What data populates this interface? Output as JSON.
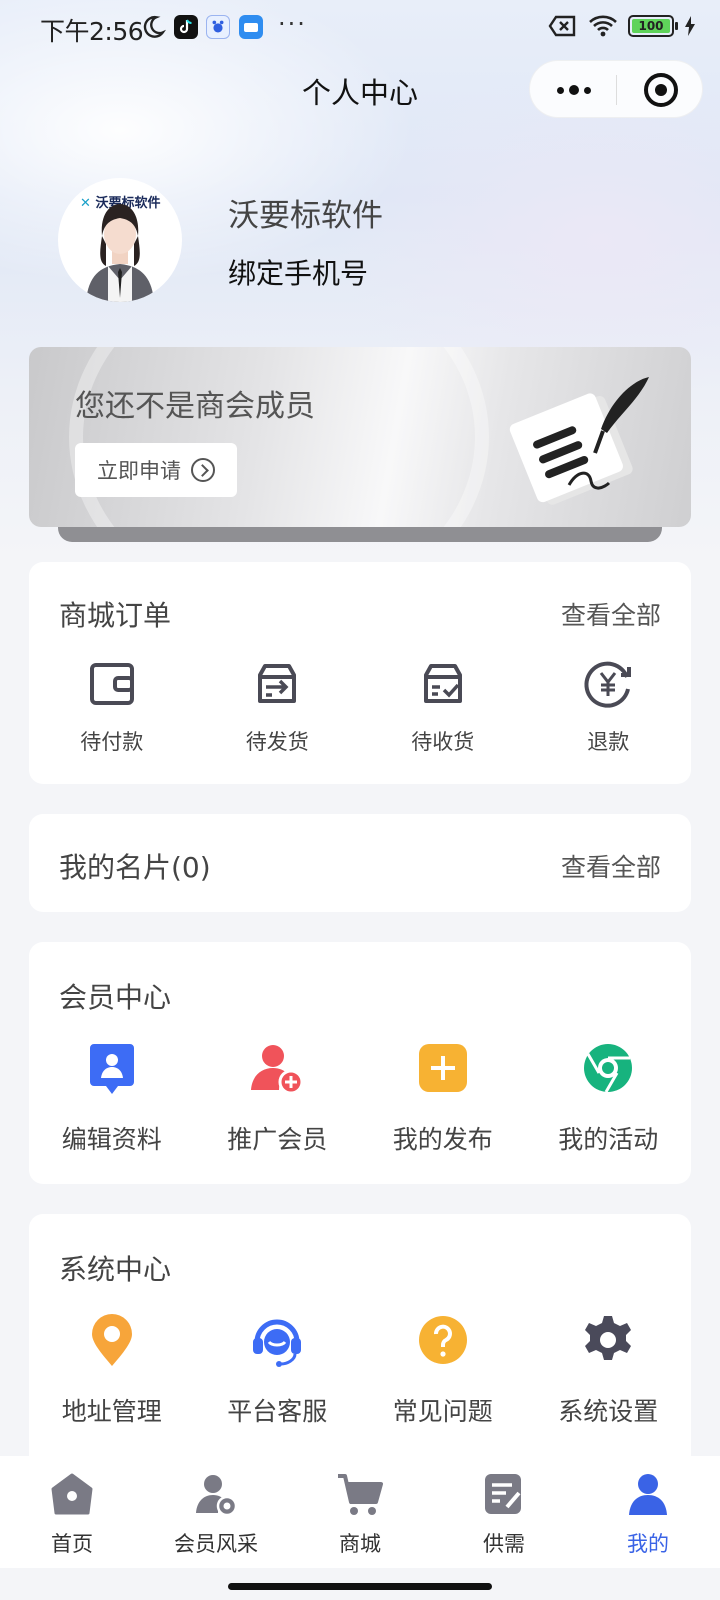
{
  "status_bar": {
    "time": "下午2:56",
    "more": "···",
    "battery": "100",
    "icons": [
      "moon-icon",
      "tiktok-app-icon",
      "baidu-app-icon",
      "wallet-app-icon",
      "sim-x-icon",
      "wifi-icon",
      "battery-icon",
      "charging-icon"
    ]
  },
  "nav": {
    "title": "个人中心",
    "capsule": [
      "more-dots-icon",
      "close-target-icon"
    ]
  },
  "profile": {
    "name": "沃要标软件",
    "bind_phone": "绑定手机号",
    "avatar_logo": "沃要标软件"
  },
  "membership_banner": {
    "title": "您还不是商会成员",
    "apply_button": "立即申请"
  },
  "orders": {
    "title": "商城订单",
    "view_all": "查看全部",
    "items": [
      {
        "label": "待付款",
        "icon": "wallet-icon"
      },
      {
        "label": "待发货",
        "icon": "box-arrow-icon"
      },
      {
        "label": "待收货",
        "icon": "box-check-icon"
      },
      {
        "label": "退款",
        "icon": "refund-yen-icon"
      }
    ]
  },
  "cards_section": {
    "title": "我的名片(0)",
    "view_all": "查看全部"
  },
  "member_center": {
    "title": "会员中心",
    "items": [
      {
        "label": "编辑资料",
        "icon": "edit-profile-icon",
        "color": "#3d6cf5"
      },
      {
        "label": "推广会员",
        "icon": "promote-member-icon",
        "color": "#f0535a"
      },
      {
        "label": "我的发布",
        "icon": "add-post-icon",
        "color": "#f7b233"
      },
      {
        "label": "我的活动",
        "icon": "activity-icon",
        "color": "#17b37e"
      }
    ]
  },
  "system_center": {
    "title": "系统中心",
    "items": [
      {
        "label": "地址管理",
        "icon": "location-pin-icon",
        "color": "#f7a53a"
      },
      {
        "label": "平台客服",
        "icon": "customer-service-icon",
        "color": "#3d6cf5"
      },
      {
        "label": "常见问题",
        "icon": "question-icon",
        "color": "#f7b233"
      },
      {
        "label": "系统设置",
        "icon": "settings-gear-icon",
        "color": "#4a4a5a"
      }
    ]
  },
  "tabbar": {
    "active_color": "#3a63e6",
    "items": [
      {
        "label": "首页",
        "icon": "home-icon"
      },
      {
        "label": "会员风采",
        "icon": "member-style-icon"
      },
      {
        "label": "商城",
        "icon": "cart-icon"
      },
      {
        "label": "供需",
        "icon": "supply-demand-icon"
      },
      {
        "label": "我的",
        "icon": "profile-icon",
        "active": true
      }
    ]
  }
}
